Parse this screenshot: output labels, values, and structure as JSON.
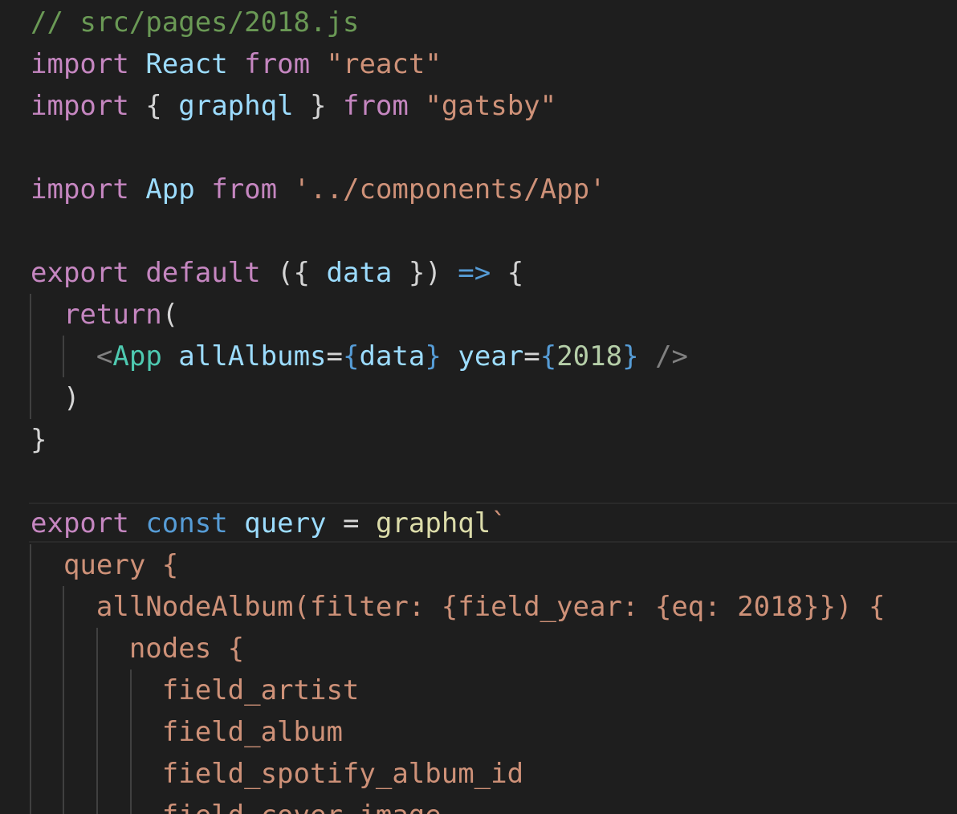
{
  "editor": {
    "language": "javascript",
    "theme_colors": {
      "background": "#1e1e1e",
      "comment": "#6a9955",
      "keyword": "#c586c0",
      "storage": "#569cd6",
      "variable": "#9cdcfe",
      "string": "#ce9178",
      "function": "#dcdcaa",
      "tag": "#4ec9b0",
      "number": "#b5cea8",
      "punctuation": "#d4d4d4"
    },
    "lines": [
      [
        {
          "t": "// src/pages/2018.js",
          "c": "comment"
        }
      ],
      [
        {
          "t": "import",
          "c": "kw"
        },
        {
          "t": " "
        },
        {
          "t": "React",
          "c": "var"
        },
        {
          "t": " "
        },
        {
          "t": "from",
          "c": "kw"
        },
        {
          "t": " "
        },
        {
          "t": "\"react\"",
          "c": "str"
        }
      ],
      [
        {
          "t": "import",
          "c": "kw"
        },
        {
          "t": " { "
        },
        {
          "t": "graphql",
          "c": "var"
        },
        {
          "t": " } "
        },
        {
          "t": "from",
          "c": "kw"
        },
        {
          "t": " "
        },
        {
          "t": "\"gatsby\"",
          "c": "str"
        }
      ],
      [],
      [
        {
          "t": "import",
          "c": "kw"
        },
        {
          "t": " "
        },
        {
          "t": "App",
          "c": "var"
        },
        {
          "t": " "
        },
        {
          "t": "from",
          "c": "kw"
        },
        {
          "t": " "
        },
        {
          "t": "'../components/App'",
          "c": "str"
        }
      ],
      [],
      [
        {
          "t": "export",
          "c": "kw"
        },
        {
          "t": " "
        },
        {
          "t": "default",
          "c": "kw"
        },
        {
          "t": " ({ "
        },
        {
          "t": "data",
          "c": "var"
        },
        {
          "t": " }) "
        },
        {
          "t": "=>",
          "c": "blue"
        },
        {
          "t": " {"
        }
      ],
      [
        {
          "t": "  "
        },
        {
          "t": "return",
          "c": "kw"
        },
        {
          "t": "("
        }
      ],
      [
        {
          "t": "    "
        },
        {
          "t": "<",
          "c": "gray"
        },
        {
          "t": "App",
          "c": "tag"
        },
        {
          "t": " "
        },
        {
          "t": "allAlbums",
          "c": "var"
        },
        {
          "t": "="
        },
        {
          "t": "{",
          "c": "blue"
        },
        {
          "t": "data",
          "c": "var"
        },
        {
          "t": "}",
          "c": "blue"
        },
        {
          "t": " "
        },
        {
          "t": "year",
          "c": "var"
        },
        {
          "t": "="
        },
        {
          "t": "{",
          "c": "blue"
        },
        {
          "t": "2018",
          "c": "num"
        },
        {
          "t": "}",
          "c": "blue"
        },
        {
          "t": " "
        },
        {
          "t": "/>",
          "c": "gray"
        }
      ],
      [
        {
          "t": "  )"
        }
      ],
      [
        {
          "t": "}"
        }
      ],
      [],
      [
        {
          "t": "export",
          "c": "kw"
        },
        {
          "t": " "
        },
        {
          "t": "const",
          "c": "blue"
        },
        {
          "t": " "
        },
        {
          "t": "query",
          "c": "var"
        },
        {
          "t": " = "
        },
        {
          "t": "graphql",
          "c": "fn"
        },
        {
          "t": "`",
          "c": "str"
        }
      ],
      [
        {
          "t": "  query {",
          "c": "str"
        }
      ],
      [
        {
          "t": "    allNodeAlbum(filter: {field_year: {eq: 2018}}) {",
          "c": "str"
        }
      ],
      [
        {
          "t": "      nodes {",
          "c": "str"
        }
      ],
      [
        {
          "t": "        field_artist",
          "c": "str"
        }
      ],
      [
        {
          "t": "        field_album",
          "c": "str"
        }
      ],
      [
        {
          "t": "        field_spotify_album_id",
          "c": "str"
        }
      ],
      [
        {
          "t": "        field_cover_image",
          "c": "str"
        }
      ]
    ]
  }
}
